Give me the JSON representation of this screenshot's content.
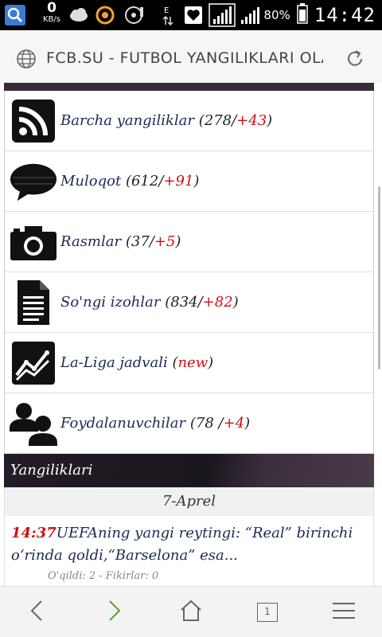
{
  "status_bar": {
    "speed_value": "0",
    "speed_unit": "KB/s",
    "battery": "80%",
    "time": "14:42"
  },
  "url_bar": {
    "title": "FCB.SU - FUTBOL YANGILIKLARI OLAMI"
  },
  "menu": [
    {
      "icon": "rss-icon",
      "label": "Barcha yangiliklar",
      "count": "(278/",
      "new": "+43",
      "close": ")"
    },
    {
      "icon": "chat-bubble-icon",
      "label": "Muloqot",
      "count": "(612/",
      "new": "+91",
      "close": ")"
    },
    {
      "icon": "camera-icon",
      "label": "Rasmlar",
      "count": "(37/",
      "new": "+5",
      "close": ")"
    },
    {
      "icon": "document-icon",
      "label": "So'ngi izohlar",
      "count": "(834/",
      "new": "+82",
      "close": ")"
    },
    {
      "icon": "chart-icon",
      "label": "La-Liga jadvali",
      "count": "(",
      "new": "new",
      "close": ")"
    },
    {
      "icon": "users-icon",
      "label": "Foydalanuvchilar",
      "count": "(78 /",
      "new": "+4",
      "close": ")"
    }
  ],
  "section": {
    "title": "Yangiliklari"
  },
  "date": "7-Aprel",
  "news": [
    {
      "time": "14:37",
      "title": "UEFAning yangi reytingi: “Real” birinchi o‘rinda qoldi,“Barselona” esa...",
      "meta": "O'qildi: 2 - Fikirlar: 0"
    }
  ],
  "bottom_nav": {
    "tab_count": "1"
  },
  "colors": {
    "link": "#1b2a55",
    "highlight": "#d01010",
    "section_bg": "#1a161d"
  }
}
